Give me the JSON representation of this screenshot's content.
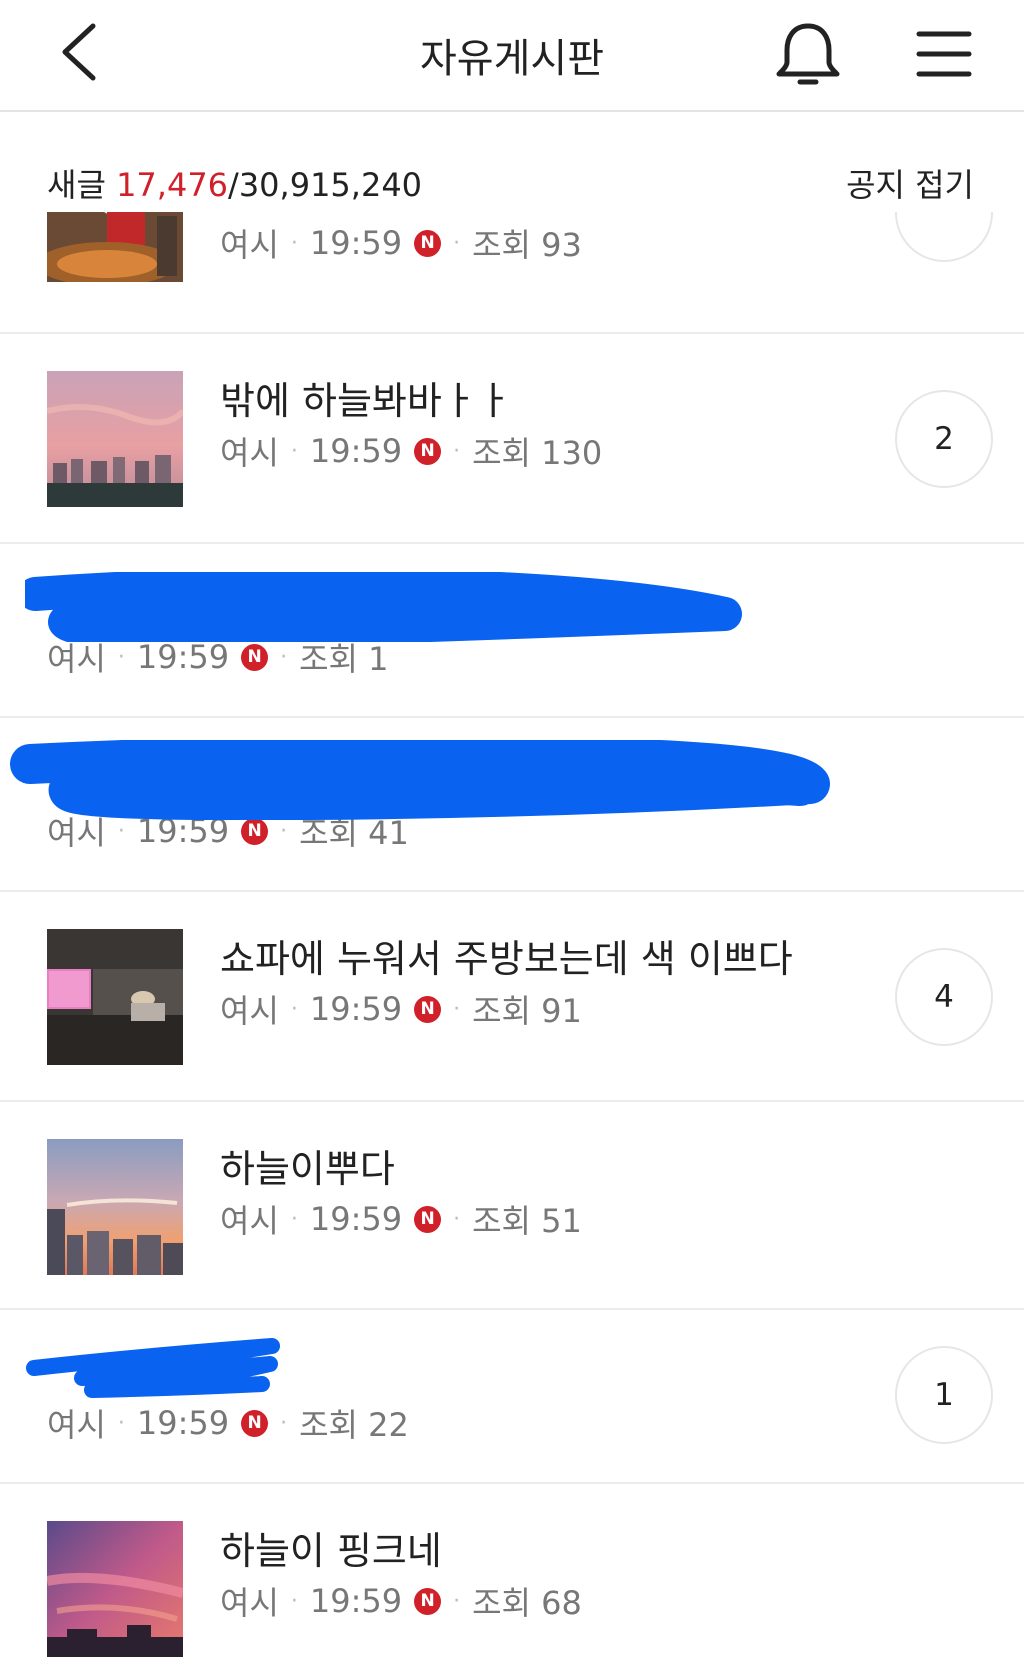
{
  "header": {
    "title": "자유게시판",
    "back_icon": "chevron-left-icon",
    "bell_icon": "bell-icon",
    "menu_icon": "hamburger-menu-icon"
  },
  "stats": {
    "label": "새글",
    "new_count": "17,476",
    "separator": "/",
    "total_count": "30,915,240",
    "notice_toggle": "공지 접기",
    "new_count_color": "#d0202a"
  },
  "badge_letter": "N",
  "posts": [
    {
      "title": "",
      "author": "여시",
      "time": "19:59",
      "views": "조회 93",
      "comments": "",
      "thumbnail": "food-photo"
    },
    {
      "title": "밖에 하늘봐바ㅏㅏ",
      "author": "여시",
      "time": "19:59",
      "views": "조회 130",
      "comments": "2",
      "thumbnail": "pink-sky-apartments"
    },
    {
      "title": "",
      "author": "여시",
      "time": "19:59",
      "views": "조회 1",
      "comments": ""
    },
    {
      "title": "",
      "author": "여시",
      "time": "19:59",
      "views": "조회 41",
      "comments": ""
    },
    {
      "title": "쇼파에 누워서 주방보는데 색 이쁘다",
      "author": "여시",
      "time": "19:59",
      "views": "조회 91",
      "comments": "4",
      "thumbnail": "kitchen-interior"
    },
    {
      "title": "하늘이뿌다",
      "author": "여시",
      "time": "19:59",
      "views": "조회 51",
      "comments": "",
      "thumbnail": "sunset-city"
    },
    {
      "title": "",
      "author": "여시",
      "time": "19:59",
      "views": "조회 22",
      "comments": "1"
    },
    {
      "title": "하늘이 핑크네",
      "author": "여시",
      "time": "19:59",
      "views": "조회 68",
      "comments": "",
      "thumbnail": "pink-evening-sky"
    }
  ],
  "colors": {
    "accent_red": "#d0202a",
    "redaction_blue": "#0a63f0"
  }
}
